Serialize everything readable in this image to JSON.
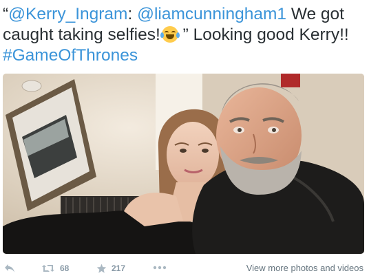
{
  "tweet": {
    "open_quote": "“",
    "mention_author": "@Kerry_Ingram",
    "colon": ":",
    "mention_target": "@liamcunningham1",
    "text_part1": "We got caught taking selfies!",
    "emoji_icon": "crying-laughing-emoji-icon",
    "text_part2": "” Looking good Kerry!!",
    "hashtag": "#GameOfThrones"
  },
  "photo": {
    "icon": "selfie-photo"
  },
  "actions": {
    "reply_icon": "reply-icon",
    "retweet_icon": "retweet-icon",
    "retweet_count": "68",
    "favorite_icon": "star-icon",
    "favorite_count": "217",
    "more_icon": "more-dots-icon",
    "view_more_label": "View more photos and videos"
  },
  "colors": {
    "link": "#3b94d9",
    "text": "#292f33",
    "muted": "#8899a6"
  }
}
